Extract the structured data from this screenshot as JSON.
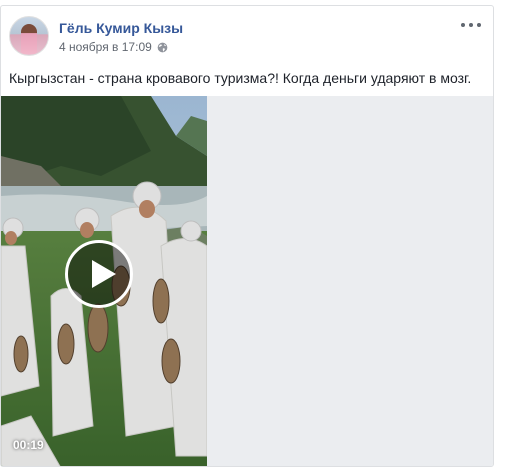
{
  "post": {
    "author": "Гёль Кумир Кызы",
    "timestamp": "4 ноября в 17:09",
    "privacy_icon": "globe-icon",
    "more_icon": "more-options-icon",
    "text": "Кыргызстан - страна кровавого туризма?! Когда деньги ударяют в мозг."
  },
  "video": {
    "duration": "00:19",
    "play_icon": "play-icon"
  },
  "colors": {
    "author_link": "#365899",
    "meta_text": "#616770",
    "body_text": "#1d2129",
    "card_border": "#dddfe2"
  }
}
